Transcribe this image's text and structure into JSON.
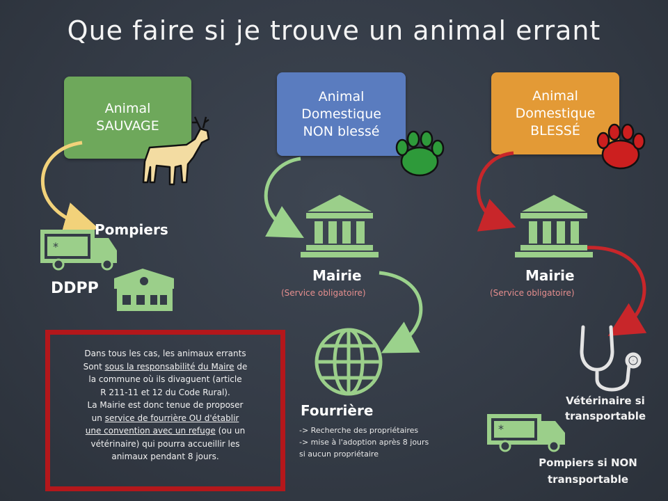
{
  "title": "Que faire si je trouve un animal errant",
  "categories": {
    "wild": "Animal\nSAUVAGE",
    "domestic": "Animal\nDomestique\nNON blessé",
    "injured": "Animal\nDomestique\nBLESSÉ"
  },
  "wild_branch": {
    "fire": "Pompiers",
    "ddpp": "DDPP"
  },
  "domestic_branch": {
    "mairie": "Mairie",
    "mairie_sub": "(Service obligatoire)",
    "pound": "Fourrière",
    "pound_notes": [
      "-> Recherche des propriétaires",
      "-> mise à l'adoption après 8 jours",
      "si aucun propriétaire"
    ]
  },
  "injured_branch": {
    "mairie": "Mairie",
    "mairie_sub": "(Service obligatoire)",
    "vet": "Vétérinaire si transportable",
    "fire": "Pompiers si NON transportable"
  },
  "info_box": {
    "line1": "Dans tous les cas, les animaux errants",
    "line2a": "Sont ",
    "line2b": "sous la responsabilité du Maire",
    "line2c": " de",
    "line3": "la commune où ils divaguent (article",
    "line4": "R 211-11 et 12 du Code Rural).",
    "line5": "La Mairie est donc tenue de proposer",
    "line6a": "un ",
    "line6b": "service de fourrière OU d'établir",
    "line7a": "une convention avec un refuge",
    "line7b": " (ou un",
    "line8": "vétérinaire) qui pourra accueillir les",
    "line9": "animaux pendant 8 jours."
  },
  "colors": {
    "background": "#343b46",
    "wild": "#6ea85b",
    "domestic": "#5a7cbf",
    "injured": "#e39a36",
    "arrow_wild": "#f2d27a",
    "arrow_domestic": "#9bd28c",
    "arrow_injured": "#c8262a",
    "icon_green": "#9bcf8a",
    "paw_green": "#2e9a3a",
    "paw_red": "#cc1f1f",
    "box_border": "#b4171b"
  },
  "icons": [
    "deer-icon",
    "paw-icon",
    "building-icon",
    "ambulance-icon",
    "house-icon",
    "globe-icon",
    "stethoscope-icon"
  ]
}
